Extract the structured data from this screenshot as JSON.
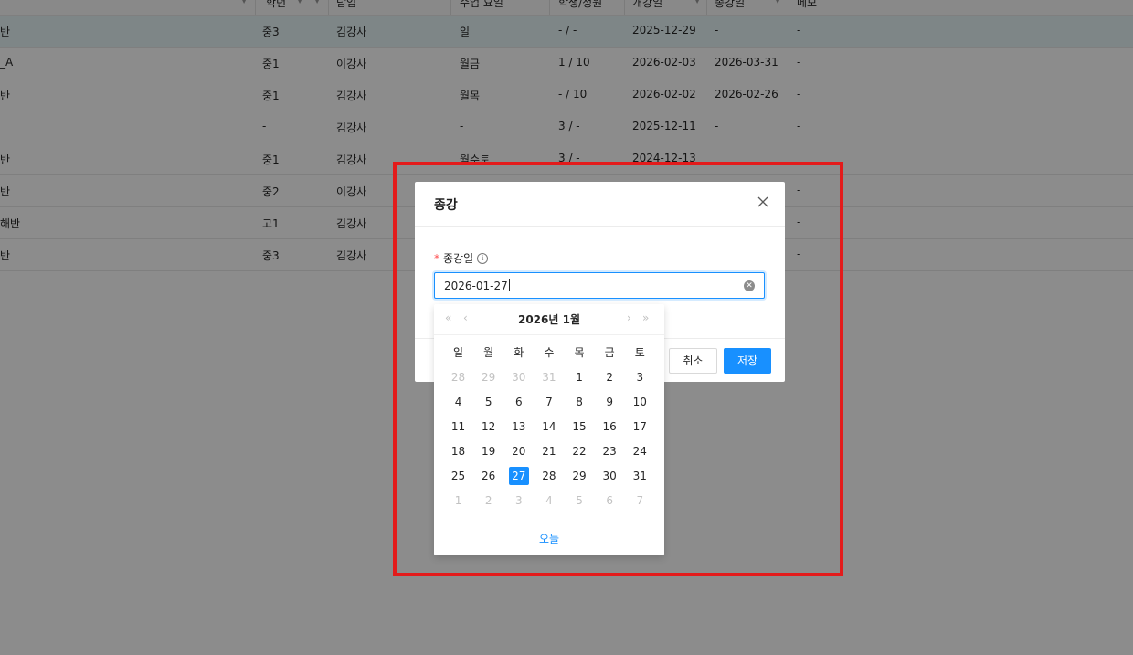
{
  "table": {
    "headers": [
      "학년",
      "담임",
      "수업 요일",
      "학생/정원",
      "개강일",
      "종강일",
      "메모"
    ],
    "rows": [
      {
        "name": "반",
        "grade": "중3",
        "teacher": "김강사",
        "days": "일",
        "students": "- / -",
        "start": "2025-12-29",
        "end": "-",
        "memo": "-"
      },
      {
        "name": "_A",
        "grade": "중1",
        "teacher": "이강사",
        "days": "월금",
        "students": "1 / 10",
        "start": "2026-02-03",
        "end": "2026-03-31",
        "memo": "-"
      },
      {
        "name": "반",
        "grade": "중1",
        "teacher": "김강사",
        "days": "월목",
        "students": "- / 10",
        "start": "2026-02-02",
        "end": "2026-02-26",
        "memo": "-"
      },
      {
        "name": "",
        "grade": "-",
        "teacher": "김강사",
        "days": "-",
        "students": "3 / -",
        "start": "2025-12-11",
        "end": "-",
        "memo": "-"
      },
      {
        "name": "반",
        "grade": "중1",
        "teacher": "김강사",
        "days": "월수토",
        "students": "3 / -",
        "start": "2024-12-13",
        "end": "",
        "memo": ""
      },
      {
        "name": "반",
        "grade": "중2",
        "teacher": "이강사",
        "days": "",
        "students": "",
        "start": "",
        "end": "",
        "memo": "-"
      },
      {
        "name": "해반",
        "grade": "고1",
        "teacher": "김강사",
        "days": "",
        "students": "",
        "start": "",
        "end": "",
        "memo": "-"
      },
      {
        "name": "반",
        "grade": "중3",
        "teacher": "김강사",
        "days": "",
        "students": "",
        "start": "",
        "end": "",
        "memo": "-"
      }
    ]
  },
  "modal": {
    "title": "종강",
    "required_mark": "*",
    "field_label": "종강일",
    "date_value": "2026-01-27",
    "cancel_label": "취소",
    "save_label": "저장"
  },
  "picker": {
    "title": "2026년  1월",
    "prev_year": "«",
    "prev_month": "‹",
    "next_month": "›",
    "next_year": "»",
    "weekdays": [
      "일",
      "월",
      "화",
      "수",
      "목",
      "금",
      "토"
    ],
    "weeks": [
      [
        {
          "d": "28",
          "m": true
        },
        {
          "d": "29",
          "m": true
        },
        {
          "d": "30",
          "m": true
        },
        {
          "d": "31",
          "m": true
        },
        {
          "d": "1"
        },
        {
          "d": "2"
        },
        {
          "d": "3"
        }
      ],
      [
        {
          "d": "4"
        },
        {
          "d": "5"
        },
        {
          "d": "6"
        },
        {
          "d": "7"
        },
        {
          "d": "8"
        },
        {
          "d": "9"
        },
        {
          "d": "10"
        }
      ],
      [
        {
          "d": "11"
        },
        {
          "d": "12"
        },
        {
          "d": "13"
        },
        {
          "d": "14"
        },
        {
          "d": "15"
        },
        {
          "d": "16"
        },
        {
          "d": "17"
        }
      ],
      [
        {
          "d": "18"
        },
        {
          "d": "19"
        },
        {
          "d": "20"
        },
        {
          "d": "21"
        },
        {
          "d": "22"
        },
        {
          "d": "23"
        },
        {
          "d": "24"
        }
      ],
      [
        {
          "d": "25"
        },
        {
          "d": "26"
        },
        {
          "d": "27",
          "sel": true
        },
        {
          "d": "28"
        },
        {
          "d": "29"
        },
        {
          "d": "30"
        },
        {
          "d": "31"
        }
      ],
      [
        {
          "d": "1",
          "m": true
        },
        {
          "d": "2",
          "m": true
        },
        {
          "d": "3",
          "m": true
        },
        {
          "d": "4",
          "m": true
        },
        {
          "d": "5",
          "m": true
        },
        {
          "d": "6",
          "m": true
        },
        {
          "d": "7",
          "m": true
        }
      ]
    ],
    "today_label": "오늘"
  },
  "colors": {
    "accent": "#1890ff",
    "required": "#ff4d4f",
    "highlight_box": "#e31b1b",
    "selected_row": "#e6f4f6"
  }
}
